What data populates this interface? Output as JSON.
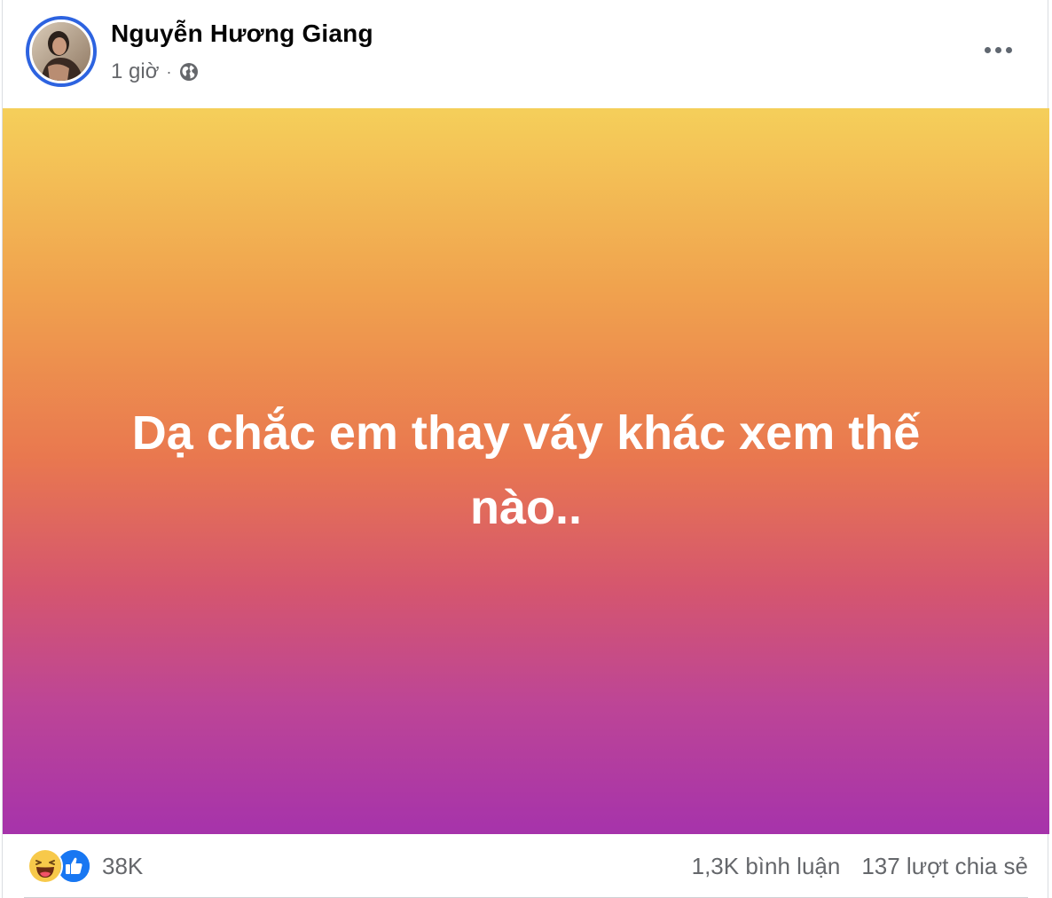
{
  "post": {
    "author": {
      "name": "Nguyễn Hương Giang",
      "avatar_icon": "profile-photo"
    },
    "meta": {
      "time": "1 giờ",
      "separator": "·",
      "privacy_icon": "globe-icon"
    },
    "more_icon": "more-horizontal-icon",
    "background": {
      "gradient_top": "#f5cf5a",
      "gradient_middle": "#e9784f",
      "gradient_bottom": "#a633ab",
      "text": "Dạ chắc em thay váy khác xem thế nào.."
    },
    "footer": {
      "reaction_icons": [
        "haha-icon",
        "like-icon"
      ],
      "reaction_count": "38K",
      "comments": "1,3K bình luận",
      "shares": "137 lượt chia sẻ"
    }
  },
  "colors": {
    "like_blue": "#1877f2",
    "haha_yellow": "#f7c94a",
    "avatar_ring": "#2d63e0",
    "secondary_text": "#65676b"
  }
}
